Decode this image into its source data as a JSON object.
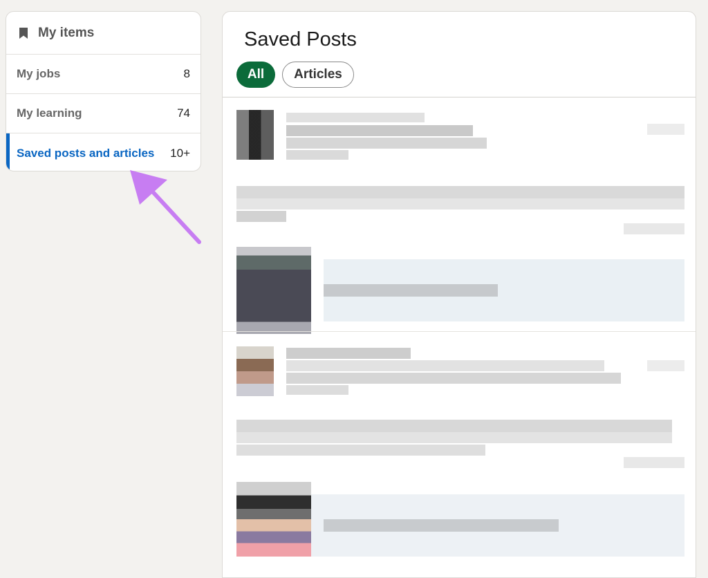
{
  "sidebar": {
    "header": {
      "icon": "bookmark-icon",
      "title": "My items"
    },
    "items": [
      {
        "label": "My jobs",
        "count": "8",
        "active": false
      },
      {
        "label": "My learning",
        "count": "74",
        "active": false
      },
      {
        "label": "Saved posts and articles",
        "count": "10+",
        "active": true
      }
    ]
  },
  "main": {
    "title": "Saved Posts",
    "filters": [
      {
        "label": "All",
        "active": true
      },
      {
        "label": "Articles",
        "active": false
      }
    ]
  },
  "colors": {
    "accent_blue": "#0a66c2",
    "pill_green": "#0b6b3a",
    "annotation_arrow": "#c77df2",
    "page_bg": "#f3f2ef"
  }
}
